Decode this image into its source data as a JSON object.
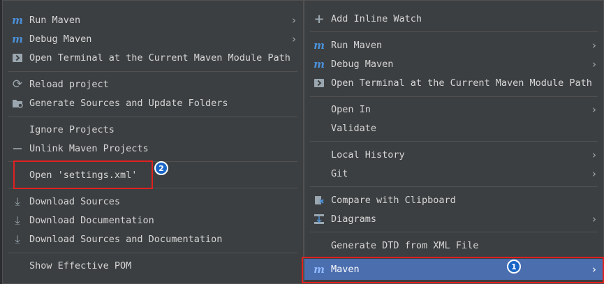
{
  "left_menu": {
    "items": [
      {
        "label": "Run Maven",
        "icon": "maven-run-icon",
        "submenu": true
      },
      {
        "label": "Debug Maven",
        "icon": "maven-debug-icon",
        "submenu": true
      },
      {
        "label": "Open Terminal at the Current Maven Module Path",
        "icon": "terminal-icon"
      },
      {
        "label": "Reload project",
        "icon": "reload-icon"
      },
      {
        "label": "Generate Sources and Update Folders",
        "icon": "folder-refresh-icon"
      },
      {
        "label": "Ignore Projects"
      },
      {
        "label": "Unlink Maven Projects",
        "icon": "minus-icon"
      },
      {
        "label": "Open 'settings.xml'"
      },
      {
        "label": "Download Sources",
        "icon": "download-icon"
      },
      {
        "label": "Download Documentation",
        "icon": "download-icon"
      },
      {
        "label": "Download Sources and Documentation",
        "icon": "download-icon"
      },
      {
        "label": "Show Effective POM"
      }
    ]
  },
  "right_menu": {
    "items": [
      {
        "label": "Add Inline Watch",
        "icon": "add-watch-icon"
      },
      {
        "label": "Run Maven",
        "icon": "maven-run-icon",
        "submenu": true
      },
      {
        "label": "Debug Maven",
        "icon": "maven-debug-icon",
        "submenu": true
      },
      {
        "label": "Open Terminal at the Current Maven Module Path",
        "icon": "terminal-icon"
      },
      {
        "label": "Open In",
        "submenu": true
      },
      {
        "label": "Validate"
      },
      {
        "label": "Local History",
        "submenu": true
      },
      {
        "label": "Git",
        "submenu": true
      },
      {
        "label": "Compare with Clipboard",
        "icon": "compare-icon"
      },
      {
        "label": "Diagrams",
        "icon": "diagram-icon",
        "submenu": true
      },
      {
        "label": "Generate DTD from XML File"
      },
      {
        "label": "Maven",
        "icon": "maven-icon",
        "submenu": true,
        "selected": true
      }
    ]
  },
  "annotations": {
    "badge_1": "1",
    "badge_2": "2"
  },
  "glyphs": {
    "arrow": "›",
    "maven": "m",
    "plus": "+",
    "minus": "—",
    "reload": "⟳",
    "download": "⤓"
  },
  "colors": {
    "menu_bg": "#3c3f41",
    "selection": "#4b6eaf",
    "highlight_box": "#e02020",
    "badge": "#1a66c7"
  }
}
